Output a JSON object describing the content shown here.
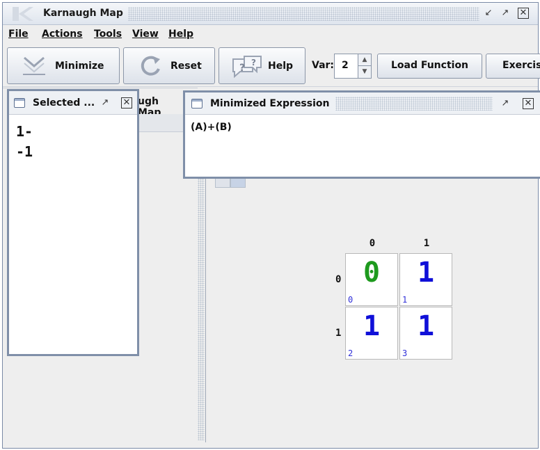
{
  "window": {
    "title": "Karnaugh Map"
  },
  "menu": {
    "file": "File",
    "actions": "Actions",
    "tools": "Tools",
    "view": "View",
    "help": "Help"
  },
  "toolbar": {
    "minimize": "Minimize",
    "reset": "Reset",
    "help": "Help",
    "var_label": "Var:",
    "var_value": "2",
    "load_function": "Load Function",
    "exercise": "Exercis"
  },
  "selected_panel": {
    "title": "Selected ...",
    "lines": [
      "1-",
      "-1"
    ]
  },
  "hidden_tab": {
    "label": "ugh Map"
  },
  "minimized_panel": {
    "title": "Minimized Expression",
    "expression": "(A)+(B)"
  },
  "kmap": {
    "col_headers": [
      "0",
      "1"
    ],
    "row_headers": [
      "0",
      "1"
    ],
    "cells": [
      {
        "value": "0",
        "index": "0",
        "color": "#1e9a1e"
      },
      {
        "value": "1",
        "index": "1",
        "color": "#1010d8"
      },
      {
        "value": "1",
        "index": "2",
        "color": "#1010d8"
      },
      {
        "value": "1",
        "index": "3",
        "color": "#1010d8"
      }
    ]
  }
}
